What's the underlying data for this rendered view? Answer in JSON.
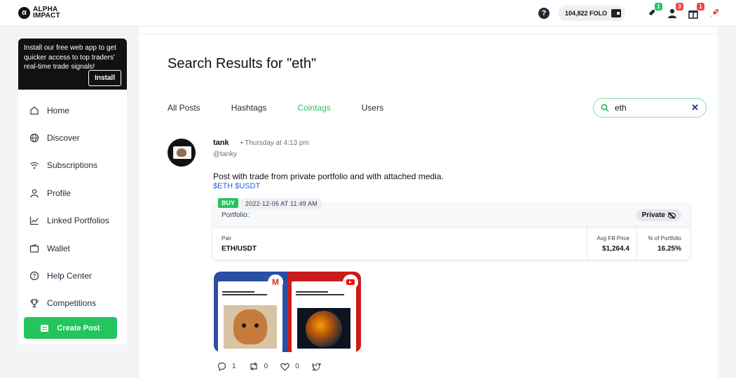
{
  "brand": {
    "logo_letter": "α",
    "name_line1": "ALPHA",
    "name_line2": "IMPACT"
  },
  "header": {
    "folo_balance": "104,822 FOLO",
    "badges": {
      "alerts": "1",
      "users": "3",
      "gifts": "1"
    }
  },
  "sidebar": {
    "install_text": "Install our free web app to get quicker access to top traders' real-time trade signals!",
    "install_button": "Install",
    "items": [
      {
        "label": "Home",
        "icon": "home-icon"
      },
      {
        "label": "Discover",
        "icon": "globe-icon"
      },
      {
        "label": "Subscriptions",
        "icon": "wifi-icon"
      },
      {
        "label": "Profile",
        "icon": "user-icon"
      },
      {
        "label": "Linked Portfolios",
        "icon": "chart-line-icon"
      },
      {
        "label": "Wallet",
        "icon": "wallet-icon"
      },
      {
        "label": "Help Center",
        "icon": "question-icon"
      },
      {
        "label": "Competitions",
        "icon": "trophy-icon"
      }
    ],
    "create_post": "Create Post"
  },
  "main": {
    "title": "Search Results for \"eth\"",
    "tabs": [
      {
        "label": "All Posts",
        "active": false
      },
      {
        "label": "Hashtags",
        "active": false
      },
      {
        "label": "Cointags",
        "active": true
      },
      {
        "label": "Users",
        "active": false
      }
    ],
    "search": {
      "value": "eth"
    },
    "accent_color": "#22c55e"
  },
  "post": {
    "author": "tank",
    "time": "• Thursday at 4:13 pm",
    "handle": "@tanky",
    "text": "Post with trade from private portfolio and with attached media.",
    "tags": "$ETH $USDT",
    "trade": {
      "side": "BUY",
      "date": "2022-12-06 AT 11:49 AM",
      "portfolio_label": "Portfolio:",
      "privacy": "Private",
      "pair_label": "Pair",
      "pair_value": "ETH/USDT",
      "fill_label": "Avg Fill Price",
      "fill_value": "$1,264.4",
      "pct_label": "% of Portfolio",
      "pct_value": "16.25%"
    },
    "actions": {
      "comments": "1",
      "reposts": "0",
      "likes": "0"
    }
  }
}
